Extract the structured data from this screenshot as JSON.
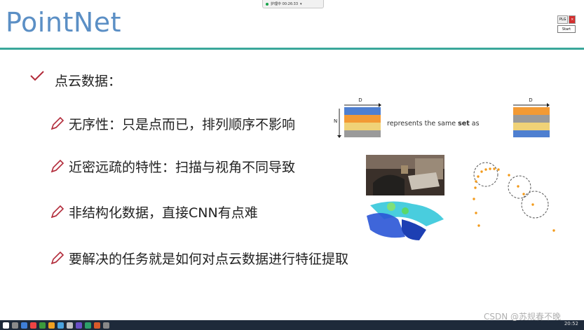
{
  "topbar": {
    "text": "护理中 00:26:33"
  },
  "slide": {
    "title": "PointNet",
    "heading": "点云数据：",
    "bullets": [
      "无序性：只是点而已，排列顺序不影响",
      "近密远疏的特性：扫描与视角不同导致",
      "非结构化数据，直接CNN有点难",
      "要解决的任务就是如何对点云数据进行特征提取"
    ],
    "figure": {
      "d_label": "D",
      "n_label": "N",
      "text_before": "represents the same ",
      "text_bold": "set",
      "text_after": " as",
      "left_stripes": [
        "#4e7fd0",
        "#f39a34",
        "#f0d277",
        "#9a9a9a"
      ],
      "right_stripes": [
        "#f39a34",
        "#9a9a9a",
        "#f0d277",
        "#4e7fd0"
      ]
    }
  },
  "controls": {
    "small_label": "PLG",
    "start_label": "Start"
  },
  "taskbar": {
    "time": "20:52"
  },
  "watermark": "CSDN @苏规春不晚"
}
